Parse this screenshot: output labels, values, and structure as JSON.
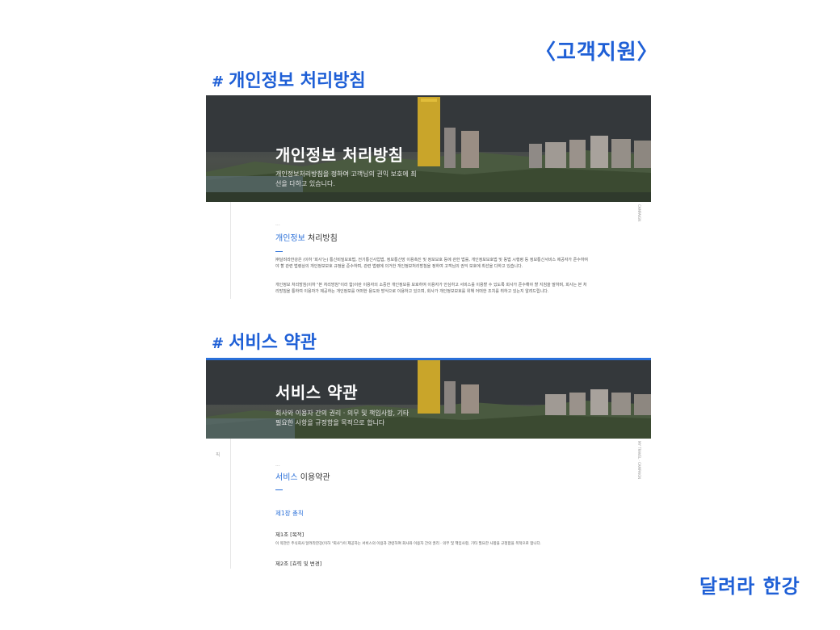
{
  "header_tag": "〈고객지원〉",
  "brand": "달려라 한강",
  "sections": [
    {
      "title": "개인정보 처리방침",
      "hero_title": "개인정보 처리방침",
      "hero_sub": "개인정보처리방침을 정하여 고객님의 권익 보호에 최선을 다하고 있습니다.",
      "side_text": "CAMPAIGN",
      "dots": "...",
      "content_head_hl": "개인정보",
      "content_head_rest": " 처리방침",
      "paragraphs": [
        "㈜달려라한강은 (이하 '회사'는) 통신비밀보호법, 전기통신사업법, 정보통신망 이용촉진 및 정보보호 등에 관한 법률, 개인정보보호법 및 동법 시행령 등 정보통신서비스 제공자가 준수하여야 할 관련 법령상의 개인정보보호 규정을 준수하며, 관련 법령에 의거한 개인정보처리방침을 정하여 고객님의 권익 보호에 최선을 다하고 있습니다.",
        "개인정보 처리방침(이하 \"본 처리방침\"이라 함)이란 이용자의 소중한 개인정보를 보호하여 이용자가 안심하고 서비스를 이용할 수 있도록 회사가 준수해야 할 지침을 말하며, 회사는 본 처리방침을 통하여 이용자가 제공하는 개인정보를 어떠한 용도와 방식으로 이용하고 있으며, 회사가 개인정보보호를 위해 어떠한 조치를 취하고 있는지 알려드립니다."
      ]
    },
    {
      "title": "서비스 약관",
      "hero_title": "서비스 약관",
      "hero_sub": "회사와 이용자 간의 권리 · 의무 및 책임사항, 기타 필요한 사항을 규정함을 목적으로 합니다",
      "side_text": "MY TRAVEL · CAMPAIGN",
      "side_mark": "픽",
      "dots": "...",
      "content_head_hl": "서비스",
      "content_head_rest": " 이용약관",
      "chapter": "제1장 총칙",
      "article1": "제1조 [목적]",
      "article1_body": "이 약관은 주식회사 달려라한강(이하 \"회사\")이 제공하는 서비스의 이용과 관련하여 회사와 이용자 간의 권리 · 의무 및 책임사항, 기타 필요한 사항을 규정함을 목적으로 합니다.",
      "article2": "제2조 [효력 및 변경]"
    }
  ],
  "colors": {
    "accent": "#1e5fd6",
    "link": "#2a6fd8"
  },
  "icons": {
    "hash": "#"
  }
}
